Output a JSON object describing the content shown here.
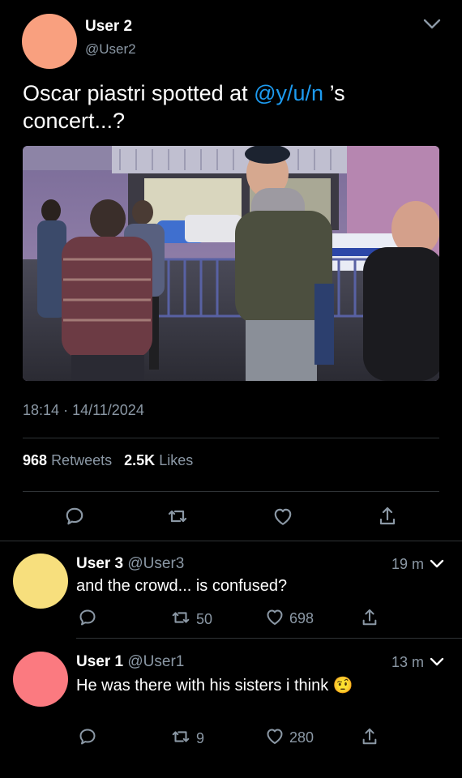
{
  "main_tweet": {
    "user_name": "User 2",
    "handle": "@User2",
    "avatar_color": "#f9a07f",
    "text_before": "Oscar piastri spotted at ",
    "mention": "@y/u/n",
    "text_after": " ’s concert...?",
    "time": "18:14",
    "separator": "·",
    "date": "14/11/2024",
    "retweet_count": "968",
    "retweet_label": "Retweets",
    "like_count": "2.5K",
    "like_label": "Likes",
    "actions": [
      "reply-icon",
      "retweet-icon",
      "heart-icon",
      "share-icon"
    ]
  },
  "replies": [
    {
      "user_name": "User 3",
      "handle": "@User3",
      "avatar_color": "#f7df7d",
      "time_ago": "19 m",
      "text": "and the crowd... is confused?",
      "emoji": "",
      "retweets": "50",
      "likes": "698"
    },
    {
      "user_name": "User 1",
      "handle": "@User1",
      "avatar_color": "#fb7a80",
      "time_ago": "13 m",
      "text": "He was there with his sisters i think",
      "emoji": "🤨",
      "retweets": "9",
      "likes": "280"
    }
  ],
  "colors": {
    "background": "#000000",
    "text": "#ffffff",
    "muted": "#8b98a5",
    "link": "#1d9bf0",
    "divider": "#2f3336"
  }
}
